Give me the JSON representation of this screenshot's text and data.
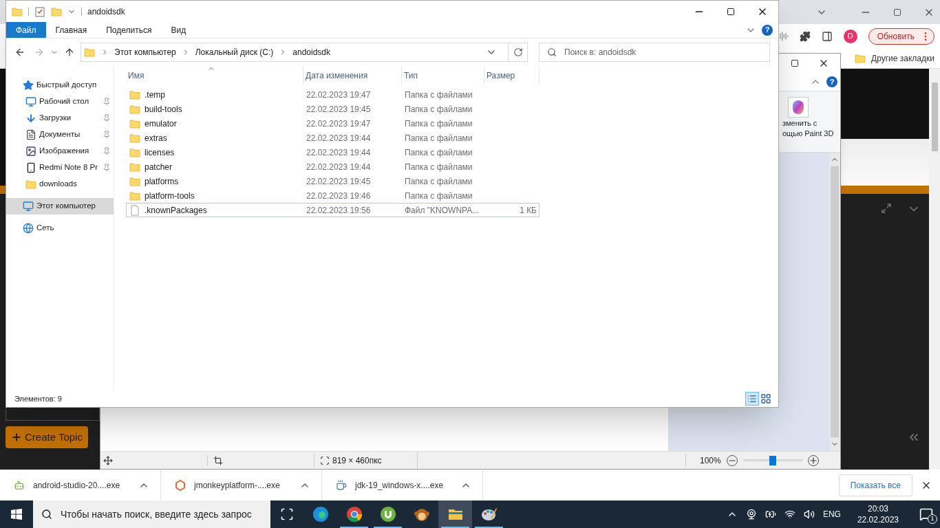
{
  "browser": {
    "avatar": "D",
    "update_button": "Обновить",
    "bookmark": "Другие закладки",
    "create_topic": "Create Topic"
  },
  "paint": {
    "help": "?",
    "ribbon_lines": [
      "зменить с",
      "ощью Paint 3D"
    ],
    "image_size": "819 × 460пкс",
    "zoom": "100%",
    "zoom_slider": {
      "level": 0.5
    }
  },
  "explorer": {
    "title": "andoidsdk",
    "help": "?",
    "ribbon_tabs": [
      {
        "label": "Файл",
        "selected": true
      },
      {
        "label": "Главная",
        "selected": false
      },
      {
        "label": "Поделиться",
        "selected": false
      },
      {
        "label": "Вид",
        "selected": false
      }
    ],
    "breadcrumb": [
      "Этот компьютер",
      "Локальный диск (C:)",
      "andoidsdk"
    ],
    "search": {
      "placeholder": "Поиск в: andoidsdk"
    },
    "sidebar": [
      {
        "label": "Быстрый доступ",
        "kind": "star",
        "pinned": false,
        "selected": false,
        "children": [
          {
            "label": "Рабочий стол",
            "kind": "desktop",
            "pinned": true,
            "selected": false
          },
          {
            "label": "Загрузки",
            "kind": "download",
            "pinned": true,
            "selected": false
          },
          {
            "label": "Документы",
            "kind": "document",
            "pinned": true,
            "selected": false
          },
          {
            "label": "Изображения",
            "kind": "picture",
            "pinned": true,
            "selected": false
          },
          {
            "label": "Redmi Note 8 Pr",
            "kind": "phone",
            "pinned": true,
            "selected": false
          },
          {
            "label": "downloads",
            "kind": "folder",
            "pinned": false,
            "selected": false
          }
        ]
      },
      {
        "label": "Этот компьютер",
        "kind": "computer",
        "pinned": false,
        "selected": true
      },
      {
        "label": "Сеть",
        "kind": "network",
        "pinned": false,
        "selected": false
      }
    ],
    "columns": [
      "Имя",
      "Дата изменения",
      "Тип",
      "Размер"
    ],
    "rows": [
      {
        "name": ".temp",
        "date": "22.02.2023 19:47",
        "type": "Папка с файлами",
        "kind": "folder",
        "focused": false
      },
      {
        "name": "build-tools",
        "date": "22.02.2023 19:45",
        "type": "Папка с файлами",
        "kind": "folder",
        "focused": false
      },
      {
        "name": "emulator",
        "date": "22.02.2023 19:47",
        "type": "Папка с файлами",
        "kind": "folder",
        "focused": false
      },
      {
        "name": "extras",
        "date": "22.02.2023 19:44",
        "type": "Папка с файлами",
        "kind": "folder",
        "focused": false
      },
      {
        "name": "licenses",
        "date": "22.02.2023 19:44",
        "type": "Папка с файлами",
        "kind": "folder",
        "focused": false
      },
      {
        "name": "patcher",
        "date": "22.02.2023 19:44",
        "type": "Папка с файлами",
        "kind": "folder",
        "focused": false
      },
      {
        "name": "platforms",
        "date": "22.02.2023 19:45",
        "type": "Папка с файлами",
        "kind": "folder",
        "focused": false
      },
      {
        "name": "platform-tools",
        "date": "22.02.2023 19:46",
        "type": "Папка с файлами",
        "kind": "folder",
        "focused": false
      },
      {
        "name": ".knownPackages",
        "date": "22.02.2023 19:56",
        "type": "Файл \"KNOWNPA...",
        "size": "1 КБ",
        "kind": "file",
        "focused": true
      }
    ],
    "status": "Элементов: 9"
  },
  "downloads": {
    "items": [
      {
        "name": "android-studio-20....exe",
        "kind": "android"
      },
      {
        "name": "jmonkeyplatform-....exe",
        "kind": "hexagon"
      },
      {
        "name": "jdk-19_windows-x....exe",
        "kind": "java"
      }
    ],
    "show_all": "Показать все"
  },
  "taskbar": {
    "search_placeholder": "Чтобы начать поиск, введите здесь запрос",
    "apps": [
      {
        "kind": "edge",
        "running": false,
        "selected": false
      },
      {
        "kind": "chrome",
        "running": true,
        "selected": false
      },
      {
        "kind": "torrent",
        "running": true,
        "selected": false
      },
      {
        "kind": "monkey",
        "running": false,
        "selected": false
      },
      {
        "kind": "explorer",
        "running": true,
        "selected": true
      },
      {
        "kind": "paint",
        "running": true,
        "selected": false
      }
    ],
    "language": "ENG",
    "time": "20:03",
    "date": "22.02.2023",
    "notifications": "1"
  }
}
